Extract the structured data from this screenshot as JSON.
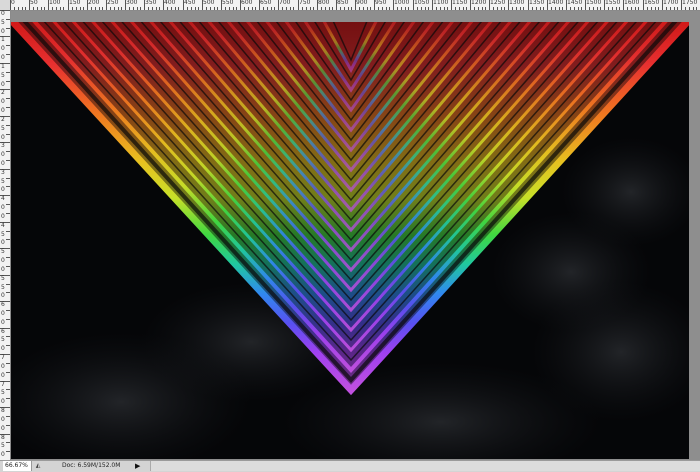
{
  "rulers": {
    "top_labels": [
      "0",
      "50",
      "100",
      "150",
      "200",
      "250",
      "300",
      "350",
      "400",
      "450",
      "500",
      "550",
      "600",
      "650",
      "700",
      "750",
      "800",
      "850",
      "900",
      "950",
      "1000",
      "1050",
      "1100",
      "1150",
      "1200",
      "1250",
      "1300",
      "1350",
      "1400",
      "1450",
      "1500",
      "1550",
      "1600",
      "1650",
      "1700",
      "1750"
    ],
    "left_labels": [
      "0",
      "5",
      "0",
      "1",
      "0",
      "0",
      "1",
      "5",
      "0",
      "2",
      "0",
      "0",
      "2",
      "5",
      "0",
      "3",
      "0",
      "0",
      "3",
      "5",
      "0",
      "4",
      "0",
      "0",
      "4",
      "5",
      "0",
      "5",
      "0",
      "0",
      "5",
      "5",
      "0",
      "6",
      "0",
      "0",
      "6",
      "5",
      "0",
      "7",
      "0",
      "0",
      "7",
      "5",
      "0",
      "8",
      "0",
      "0",
      "8",
      "5",
      "0"
    ]
  },
  "canvas": {
    "background": "#050608",
    "artwork": "rainbow-chevron",
    "colors": [
      "#d01818",
      "#e83030",
      "#f07a20",
      "#e8c020",
      "#c8e028",
      "#40d840",
      "#20c8a0",
      "#3088f0",
      "#5850f0",
      "#a040f0",
      "#c050e0"
    ]
  },
  "status": {
    "zoom": "66.67%",
    "info_icon": "info-triangle-icon",
    "doc": "Doc: 6.59M/152.0M",
    "arrow": "▶"
  }
}
